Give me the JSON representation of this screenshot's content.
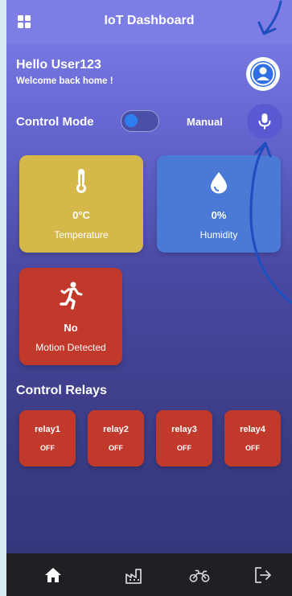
{
  "appbar": {
    "title": "IoT Dashboard",
    "menu_icon": "grid-icon"
  },
  "greeting": {
    "title": "Hello User123",
    "subtitle": "Welcome back home !"
  },
  "control_mode": {
    "label": "Control Mode",
    "value": "Manual",
    "toggle_on": false
  },
  "sensors": [
    {
      "value": "0°C",
      "label": "Temperature",
      "icon": "thermometer-icon",
      "color": "#d5b84a"
    },
    {
      "value": "0%",
      "label": "Humidity",
      "icon": "droplet-icon",
      "color": "#4b79d6"
    },
    {
      "value": "No",
      "label": "Motion Detected",
      "icon": "running-person-icon",
      "color": "#c0392b"
    }
  ],
  "relays": {
    "title": "Control Relays",
    "items": [
      {
        "name": "relay1",
        "state": "OFF"
      },
      {
        "name": "relay2",
        "state": "OFF"
      },
      {
        "name": "relay3",
        "state": "OFF"
      },
      {
        "name": "relay4",
        "state": "OFF"
      }
    ],
    "color": "#c0392b"
  },
  "bottom_nav": [
    {
      "icon": "home-icon",
      "active": true
    },
    {
      "icon": "factory-icon",
      "active": false
    },
    {
      "icon": "motorcycle-icon",
      "active": false
    },
    {
      "icon": "logout-icon",
      "active": false
    }
  ]
}
